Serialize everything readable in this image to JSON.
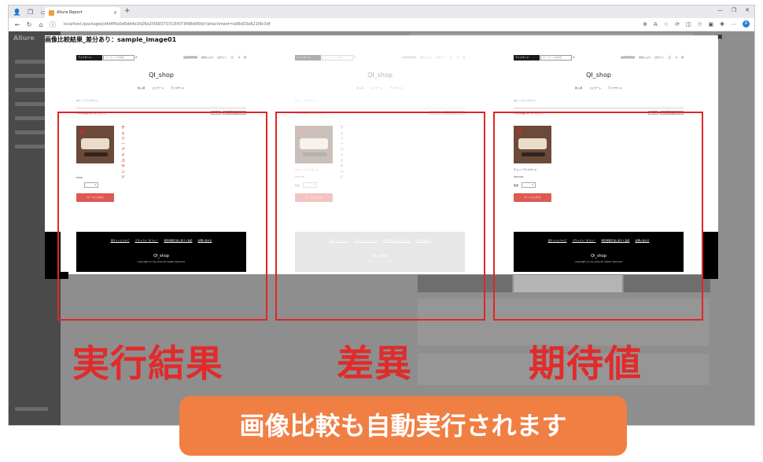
{
  "browser": {
    "tab_title": "Allure Report",
    "tab_close": "×",
    "new_tab": "+",
    "url": "localhost:/packages/dfd4f5e0d0dd4e3d26e2f399373/315f073f98d9f0d/?attachment=a96d33a621f9c3df",
    "window_controls": [
      "—",
      "❐",
      "✕"
    ],
    "profile_initial": "A"
  },
  "app": {
    "logo_text": "Allure"
  },
  "modal": {
    "title": "画像比較結果_差分あり：sample_image01",
    "close": "✖"
  },
  "shop": {
    "category_label": "アイスサンド",
    "search_placeholder": "キーワードを検索",
    "links": [
      "会員登録登録",
      "お気に入り",
      "ログイン"
    ],
    "cart_count": "0",
    "currency": "円",
    "shop_name": "QI_shop",
    "menu": [
      "新入荷",
      "ジェラート",
      "アイスサンド"
    ],
    "breadcrumb": "全て > アイスサンド",
    "result_count": "1件の商品が見つかりました",
    "sort_count": "20件",
    "sort_order": "新着順に並び替え",
    "footer_links": [
      "当サイトについて",
      "プライバシーポリシー",
      "特定商取引法に基づく表記",
      "お問い合わせ"
    ],
    "footer_name": "QI_shop",
    "footer_copy": "copyright (c) QI_shop all rights reserved."
  },
  "panels": [
    {
      "vertical_name": "チェリーアイスサンド",
      "price": "¥000",
      "qty_label": "",
      "qty_value": "1",
      "cart_button": "カートに入れる"
    },
    {
      "product_name": "チェリーアイスサンド",
      "price": "¥00,000",
      "vertical_name": "チェリーアイスサンド",
      "qty_label": "数量",
      "qty_value": "1",
      "cart_button": "カートに入れる"
    },
    {
      "product_name": "チェリーアイスサンド",
      "price": "¥00,000",
      "qty_label": "数量",
      "qty_value": "1",
      "cart_button": "カートに入れる"
    }
  ],
  "captions": {
    "actual": "実行結果",
    "diff": "差異",
    "expected": "期待値",
    "banner": "画像比較も自動実行されます"
  }
}
